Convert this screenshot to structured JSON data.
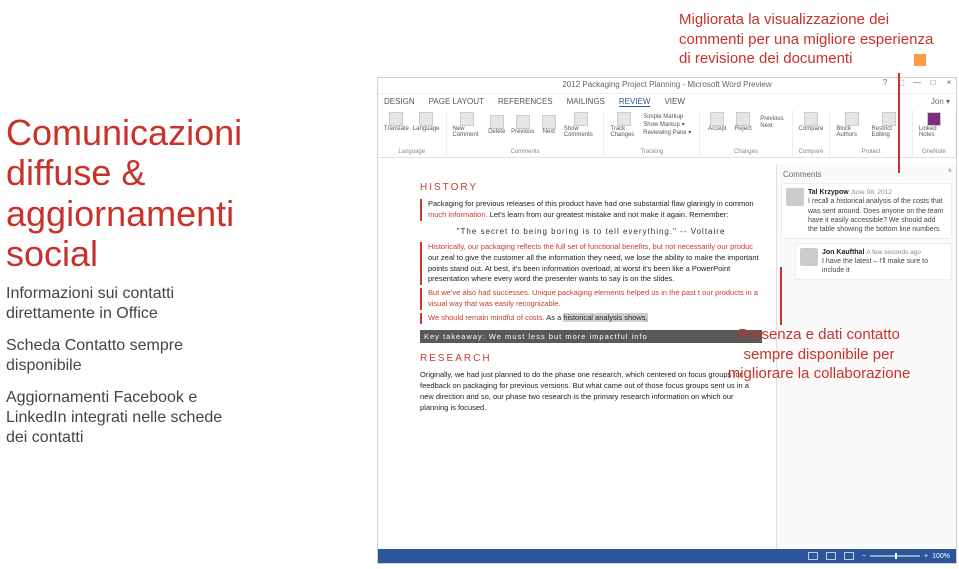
{
  "callouts": {
    "top": "Migliorata la visualizzazione dei commenti per una migliore esperienza di revisione dei documenti",
    "right": "Presenza e dati contatto sempre disponibile per migliorare la collaborazione"
  },
  "left": {
    "title": "Comunicazioni diffuse & aggiornamenti social",
    "sub1": "Informazioni sui contatti direttamente in Office",
    "sub2": "Scheda Contatto sempre disponibile",
    "sub3": "Aggiornamenti Facebook e LinkedIn integrati nelle schede dei contatti"
  },
  "word": {
    "title": "2012 Packaging Project Planning - Microsoft Word Preview",
    "user": "Jon ▾",
    "tabs": [
      "DESIGN",
      "PAGE LAYOUT",
      "REFERENCES",
      "MAILINGS",
      "REVIEW",
      "VIEW"
    ],
    "active_tab": "REVIEW",
    "ribbon": {
      "language": {
        "b1": "Translate",
        "b2": "Language",
        "group": "Language"
      },
      "comments": {
        "b1": "New Comment",
        "b2": "Delete",
        "b3": "Previous",
        "b4": "Next",
        "b5": "Show Comments",
        "group": "Comments"
      },
      "tracking": {
        "b1": "Track Changes",
        "s1": "Simple Markup",
        "s2": "Show Markup ▾",
        "s3": "Reviewing Pane ▾",
        "group": "Tracking"
      },
      "changes": {
        "b1": "Accept",
        "b2": "Reject",
        "s1": "Previous",
        "s2": "Next",
        "group": "Changes"
      },
      "compare": {
        "b1": "Compare",
        "group": "Compare"
      },
      "protect": {
        "b1": "Block Authors",
        "b2": "Restrict Editing",
        "group": "Protect"
      },
      "onenote": {
        "b1": "Linked Notes",
        "group": "OneNote"
      }
    },
    "doc": {
      "h1": "HISTORY",
      "p1a": "Packaging for previous releases of this product have had one substantial flaw glaringly in common ",
      "p1b": "much information.",
      "p1c": " Let's learn from our greatest mistake and not make it again. Remember:",
      "quote": "\"The secret to being boring is to tell everything.\" -- Voltaire",
      "p2a": "Historically, our packaging reflects the full set of functional benefits, but not necessarily our produc",
      "p2b": "our zeal to give the customer all the information they need, we lose the ability to make the important points stand out. At best, it's been information overload; at worst it's been like a PowerPoint presentation where every word the presenter wants to say is on the slides.",
      "p3": "But we've also had successes. Unique packaging elements helped us in the past t    our products in a visual way that was easily recognizable.",
      "p4a": "We should remain mindful of costs.",
      "p4b": " As a ",
      "p4c": "historical analysis shows,",
      "key": "Key takeaway: We must less but more impactful info",
      "h2": "RESEARCH",
      "p5": "Originally, we had just planned to do the phase one research, which centered on focus groups for feedback on packaging for previous versions. But what came out of those focus groups sent us in a new direction and so, our phase two research is the primary research information on which our planning is focused."
    },
    "comments": {
      "pane_title": "Comments",
      "c1": {
        "author": "Tal Krzypow",
        "time": "June 08, 2012",
        "text": "I recall a historical analysis of the costs that was sent around. Does anyone on the team have it easily accessible? We should add the table showing the bottom line numbers"
      },
      "c2": {
        "author": "Jon Kaufthal",
        "time": "A few seconds ago",
        "text": "I have the latest – I'll make sure to include it"
      }
    },
    "status": {
      "zoom": "100%"
    }
  }
}
